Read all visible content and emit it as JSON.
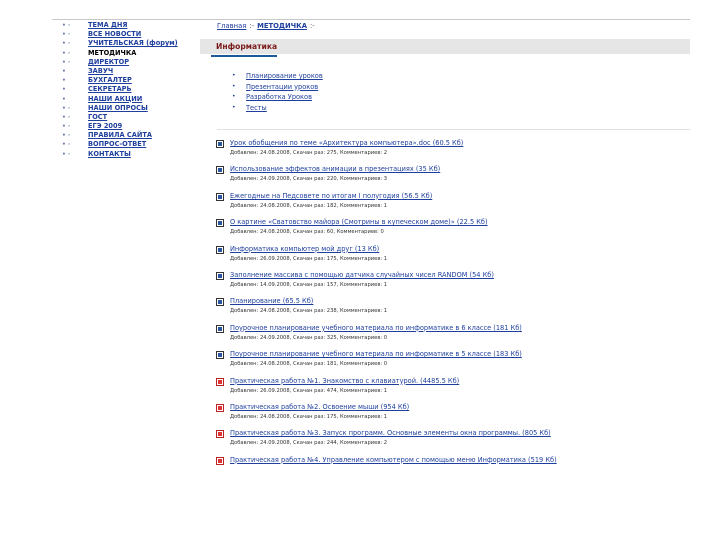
{
  "sidebar": {
    "items": [
      {
        "label": "ТЕМА ДНЯ",
        "bullet": "• ·",
        "active": false
      },
      {
        "label": "ВСЕ НОВОСТИ",
        "bullet": "• ·",
        "active": false
      },
      {
        "label": "УЧИТЕЛЬСКАЯ (форум)",
        "bullet": "• ·",
        "active": false
      },
      {
        "label": "МЕТОДИЧКА",
        "bullet": "• ·",
        "active": true
      },
      {
        "label": "ДИРЕКТОР",
        "bullet": "• ·",
        "active": false
      },
      {
        "label": "ЗАВУЧ",
        "bullet": "•",
        "active": false
      },
      {
        "label": "БУХГАЛТЕР",
        "bullet": "•",
        "active": false
      },
      {
        "label": "СЕКРЕТАРЬ",
        "bullet": "•",
        "active": false
      },
      {
        "label": "НАШИ АКЦИИ",
        "bullet": "•",
        "active": false
      },
      {
        "label": "НАШИ ОПРОСЫ",
        "bullet": "• ·",
        "active": false
      },
      {
        "label": "ГОСТ",
        "bullet": "• ·",
        "active": false
      },
      {
        "label": "ЕГЭ 2009",
        "bullet": "• ·",
        "active": false
      },
      {
        "label": "ПРАВИЛА САЙТА",
        "bullet": "• ·",
        "active": false
      },
      {
        "label": "ВОПРОС-ОТВЕТ",
        "bullet": "• ·",
        "active": false
      },
      {
        "label": "КОНТАКТЫ",
        "bullet": "• ·",
        "active": false
      }
    ]
  },
  "breadcrumb": {
    "home": "Главная",
    "sep1": ":-",
    "current": "МЕТОДИЧКА",
    "sep2": ":-"
  },
  "section": {
    "title": "Информатика"
  },
  "sublinks": [
    "Планирование уроков",
    "Презентации уроков",
    "Разработка Уроков",
    "Тесты"
  ],
  "files": [
    {
      "icon": "doc",
      "title": "Урок обобщения по теме «Архитектура компьютера».doc (60.5 Кб)",
      "meta": "Добавлен: 24.08.2008, Скачан раз: 275, Комментариев: 2"
    },
    {
      "icon": "doc",
      "title": "Использование эффектов анимации в презентациях (35 Кб)",
      "meta": "Добавлен: 24.09.2008, Скачан раз: 220, Комментариев: 3"
    },
    {
      "icon": "doc",
      "title": "Ежегодные на Педсовете по итогам I полугодия (56.5 Кб)",
      "meta": "Добавлен: 24.08.2008, Скачан раз: 182, Комментариев: 1"
    },
    {
      "icon": "doc",
      "title": "О картине «Сватовство майора (Смотрины в купеческом доме)» (22.5 Кб)",
      "meta": "Добавлен: 24.08.2008, Скачан раз: 60, Комментариев: 0"
    },
    {
      "icon": "doc",
      "title": "Информатика компьютер мой друг (13 Кб)",
      "meta": "Добавлен: 26.09.2008, Скачан раз: 175, Комментариев: 1"
    },
    {
      "icon": "doc",
      "title": "Заполнение массива с помощью датчика случайных чисел RANDOM (54 Кб)",
      "meta": "Добавлен: 14.09.2008, Скачан раз: 157, Комментариев: 1"
    },
    {
      "icon": "doc",
      "title": "Планирование (65.5 Кб)",
      "meta": "Добавлен: 24.08.2008, Скачан раз: 238, Комментариев: 1"
    },
    {
      "icon": "doc",
      "title": "Поурочное планирование учебного материала по информатике в 6 классе (181 Кб)",
      "meta": "Добавлен: 24.09.2008, Скачан раз: 325, Комментариев: 0"
    },
    {
      "icon": "doc",
      "title": "Поурочное планирование учебного материала по информатике в 5 классе (183 Кб)",
      "meta": "Добавлен: 24.08.2008, Скачан раз: 181, Комментариев: 0"
    },
    {
      "icon": "pdf",
      "title": "Практическая работа №1. Знакомство с клавиатурой. (4485.5 Кб)",
      "meta": "Добавлен: 26.09.2008, Скачан раз: 474, Комментариев: 1"
    },
    {
      "icon": "pdf",
      "title": "Практическая работа №2. Освоение мыши (954 Кб)",
      "meta": "Добавлен: 24.08.2008, Скачан раз: 175, Комментариев: 1"
    },
    {
      "icon": "pdf",
      "title": "Практическая работа №3. Запуск программ. Основные элементы окна программы. (805 Кб)",
      "meta": "Добавлен: 24.09.2008, Скачан раз: 244, Комментариев: 2"
    },
    {
      "icon": "pdf",
      "title": "Практическая работа №4. Управление компьютером с помощью меню Информатика (519 Кб)",
      "meta": ""
    }
  ]
}
